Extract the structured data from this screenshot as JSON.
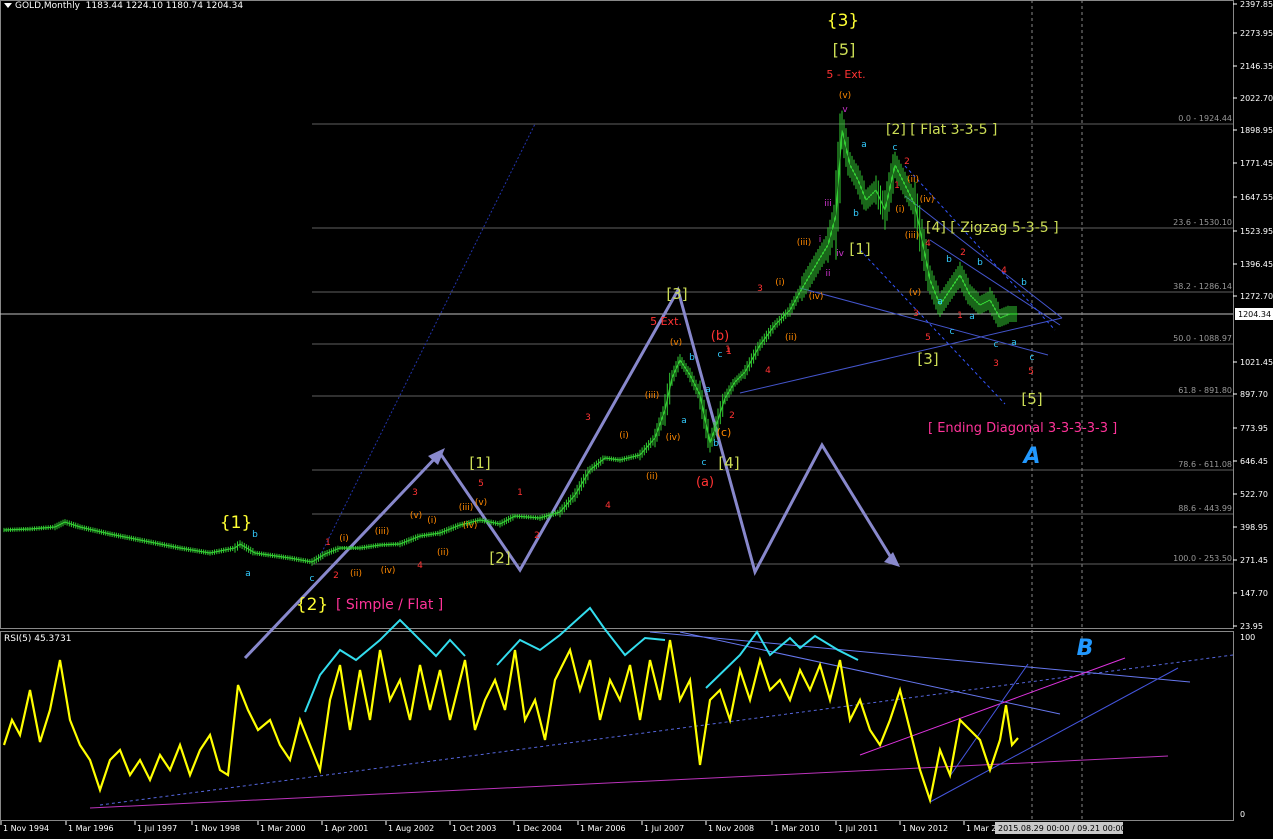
{
  "header": {
    "symbol": "GOLD,Monthly",
    "ohlc": "1183.44 1224.10 1180.74 1204.34"
  },
  "rsi": {
    "label": "RSI(5) 45.3731",
    "scale_top": "100",
    "scale_bottom": "0"
  },
  "price_axis": {
    "labels": [
      "2397.85",
      "2273.95",
      "2146.35",
      "2022.70",
      "1898.95",
      "1771.45",
      "1647.55",
      "1523.95",
      "1396.45",
      "1272.70",
      "1204.34",
      "1021.45",
      "897.70",
      "773.95",
      "646.45",
      "522.70",
      "398.95",
      "271.45",
      "147.70",
      "23.95"
    ],
    "current": "1204.34"
  },
  "time_axis": {
    "labels": [
      "1 Nov 1994",
      "1 Mar 1996",
      "1 Jul 1997",
      "1 Nov 1998",
      "1 Mar 2000",
      "1 Apr 2001",
      "1 Aug 2002",
      "1 Oct 2003",
      "1 Dec 2004",
      "1 Mar 2006",
      "1 Jul 2007",
      "1 Nov 2008",
      "1 Mar 2010",
      "1 Jul 2011",
      "1 Nov 2012",
      "1 Mar 2"
    ],
    "cursor": "2015.08.29 00:00 / 09.21 00:00"
  },
  "fib_levels": [
    "0.0 - 1924.44",
    "23.6 - 1530.10",
    "38.2 - 1286.14",
    "50.0 - 1088.97",
    "61.8 - 891.80",
    "78.6 - 611.08",
    "88.6 - 443.99",
    "100.0 - 253.50"
  ],
  "wave_labels": {
    "w3_top": "{3}",
    "w5_top": "[5]",
    "ext5": "5 - Ext.",
    "v_top": "(v)",
    "v_small": "v",
    "flat_355": "[2] [ Flat 3-3-5 ]",
    "zigzag": "[4] [ Zigzag 5-3-5 ]",
    "w1_bracket": "[1]",
    "w3_mid": "[3]",
    "w3_lower": "[3]",
    "w5_lower": "[5]",
    "ending_diag": "[ Ending Diagonal 3-3-3-3-3 ]",
    "A": "A",
    "B": "B",
    "w1_curly": "{1}",
    "w2_curly": "{2}",
    "simple_flat": "[ Simple / Flat ]",
    "w1_2001": "[1]",
    "w2_2004": "[2]",
    "w3_2008": "[3]",
    "w4_2008": "[4]",
    "ext5b": "5 Ext.",
    "b_paren": "(b)",
    "a_paren": "(a)",
    "c_paren": "(c)"
  },
  "colors": {
    "background": "#000000",
    "price": "#33cc33",
    "rsi": "#ffff00",
    "fib": "#808080",
    "wave_yellow": "#ffff33",
    "wave_green": "#ccdd55",
    "wave_red": "#ff3333",
    "wave_orange": "#ff8800",
    "wave_cyan": "#33ccff",
    "wave_magenta": "#ff3399",
    "pattern_arrows": "#8888cc",
    "rsi_arrows": "#33ddee"
  }
}
